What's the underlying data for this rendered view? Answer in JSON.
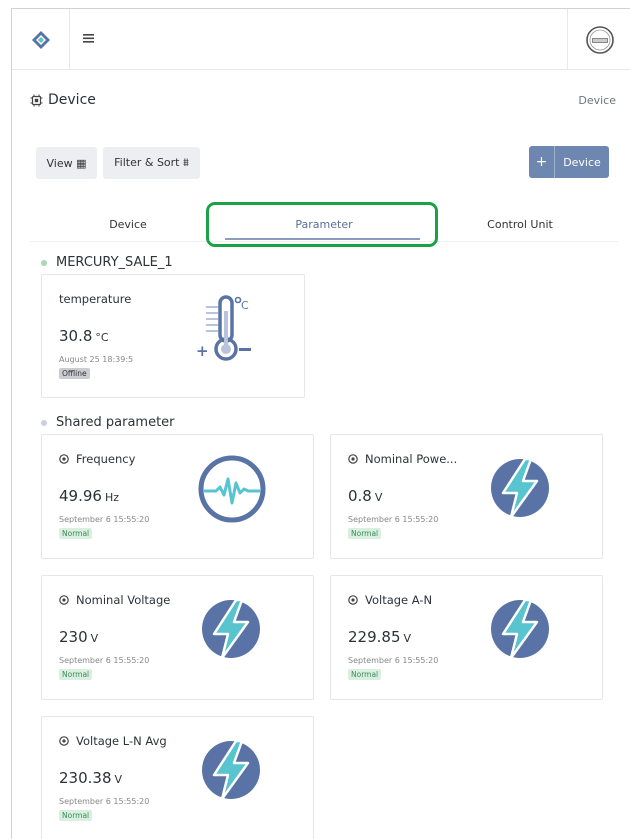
{
  "header": {
    "logo_icon": "diamond-logo-icon",
    "menu_icon": "hamburger-menu-icon",
    "avatar_icon": "company-avatar-icon"
  },
  "page": {
    "title": "Device",
    "title_icon": "chip-icon",
    "breadcrumb": "Device"
  },
  "toolbar": {
    "view_label": "View ▦",
    "filter_label": "Filter & Sort ⩩",
    "add_plus": "+",
    "add_label": "Device"
  },
  "tabs": [
    {
      "label": "Device",
      "active": false
    },
    {
      "label": "Parameter",
      "active": true
    },
    {
      "label": "Control Unit",
      "active": false
    }
  ],
  "groups": [
    {
      "title": "MERCURY_SALE_1",
      "dot_color": "#a8d8b8",
      "cards": [
        {
          "name": "temperature",
          "value": "30.8",
          "unit": "°C",
          "timestamp": "August 25 18:39:5",
          "status": "Offline",
          "icon": "thermometer-icon"
        }
      ]
    },
    {
      "title": "Shared parameter",
      "dot_color": "#c7cfe0",
      "cards": [
        {
          "name": "Frequency",
          "value": "49.96",
          "unit": "Hz",
          "timestamp": "September 6 15:55:20",
          "status": "Normal",
          "icon": "waveform-icon"
        },
        {
          "name": "Nominal Powe...",
          "value": "0.8",
          "unit": "V",
          "timestamp": "September 6 15:55:20",
          "status": "Normal",
          "icon": "lightning-icon"
        },
        {
          "name": "Nominal Voltage",
          "value": "230",
          "unit": "V",
          "timestamp": "September 6 15:55:20",
          "status": "Normal",
          "icon": "lightning-icon"
        },
        {
          "name": "Voltage A-N",
          "value": "229.85",
          "unit": "V",
          "timestamp": "September 6 15:55:20",
          "status": "Normal",
          "icon": "lightning-icon"
        },
        {
          "name": "Voltage L-N Avg",
          "value": "230.38",
          "unit": "V",
          "timestamp": "September 6 15:55:20",
          "status": "Normal",
          "icon": "lightning-icon"
        }
      ]
    }
  ],
  "colors": {
    "accent": "#6e87b0",
    "icon_navy": "#5a73a6",
    "icon_teal": "#57c4cf",
    "highlight_green": "#1aa14a"
  }
}
